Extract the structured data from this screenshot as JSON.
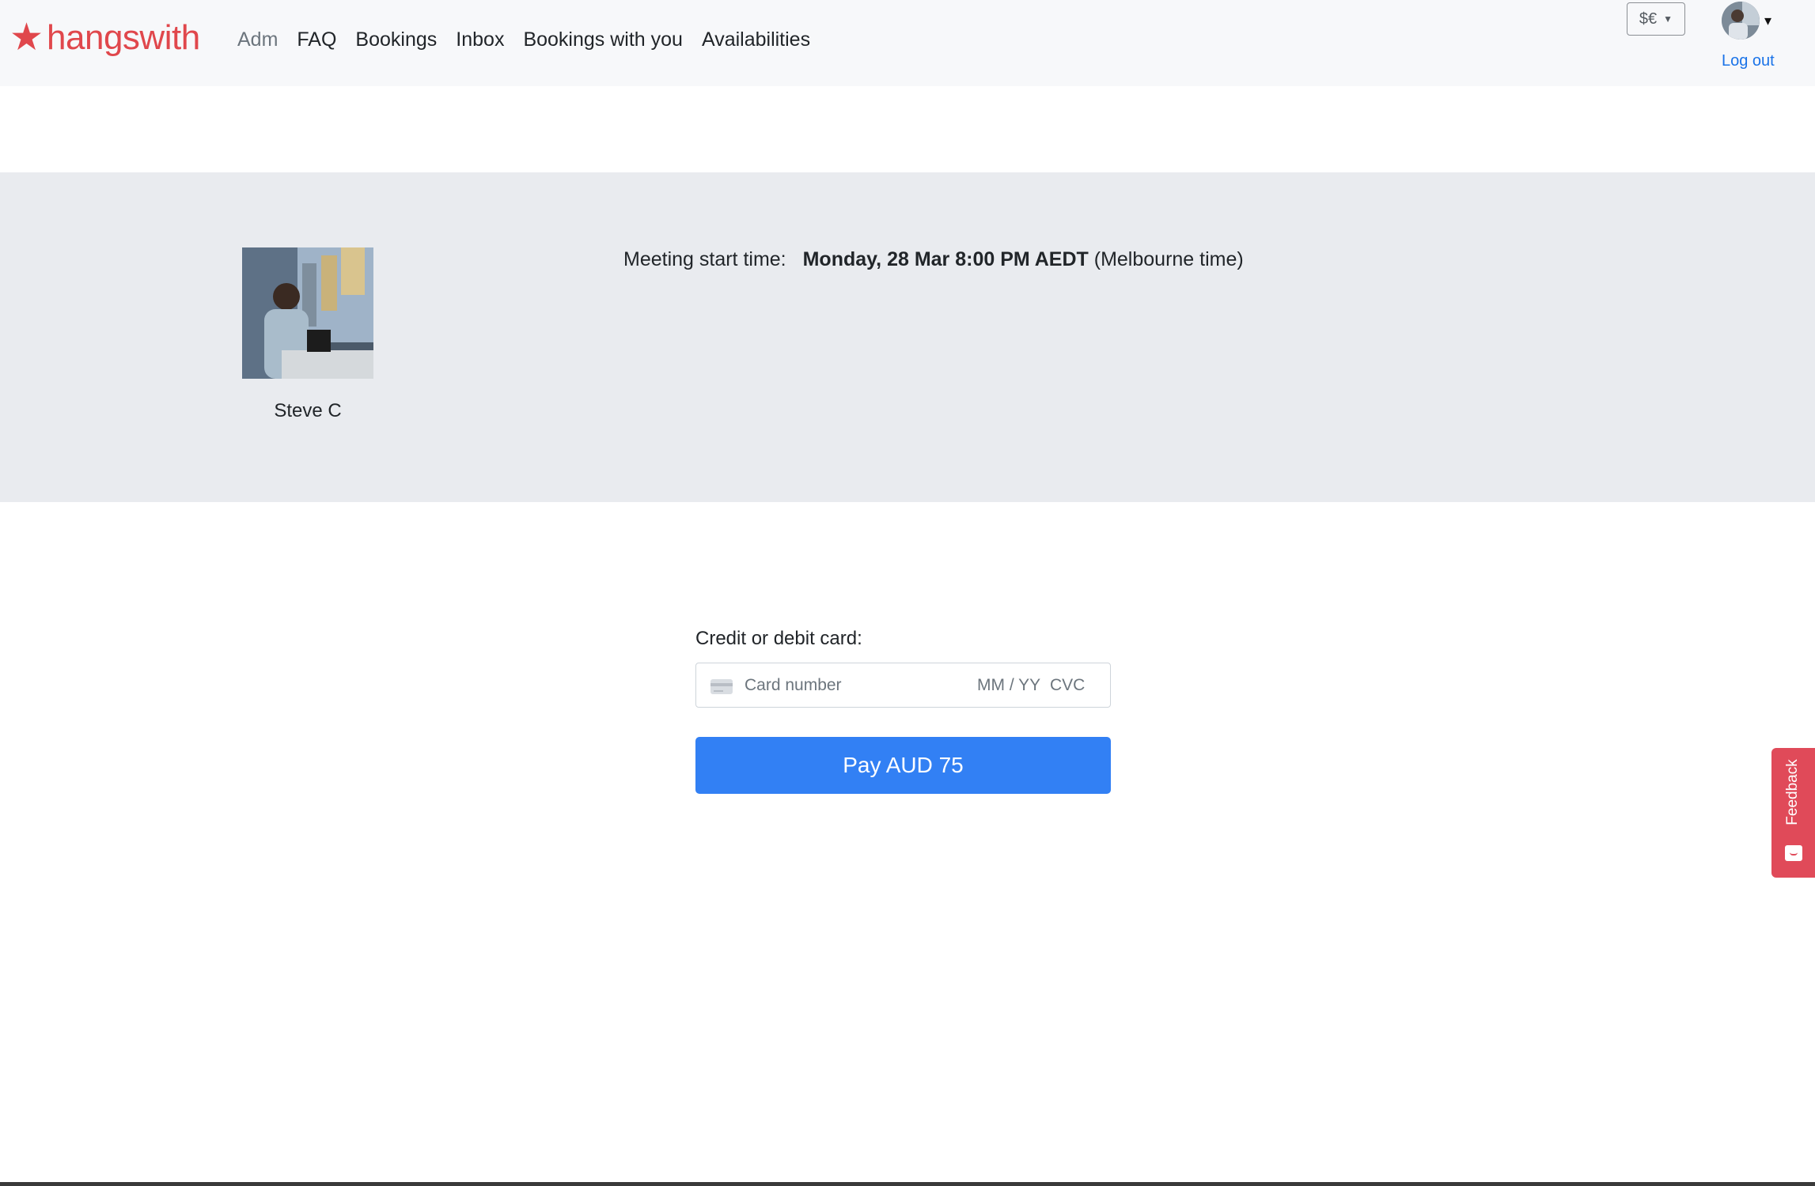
{
  "brand": {
    "star": "★",
    "name": "hangswith",
    "color": "#e0474c"
  },
  "nav": {
    "items": [
      {
        "label": "Adm",
        "muted": true
      },
      {
        "label": "FAQ"
      },
      {
        "label": "Bookings"
      },
      {
        "label": "Inbox"
      },
      {
        "label": "Bookings with you"
      },
      {
        "label": "Availabilities"
      }
    ]
  },
  "header": {
    "currency_selected": "$€",
    "currency_caret_icon": "caret-down-icon",
    "avatar_caret": "▾",
    "logout_label": "Log out"
  },
  "meeting": {
    "host_name": "Steve C",
    "start_label": "Meeting start time:",
    "start_value": "Monday, 28 Mar 8:00 PM AEDT",
    "timezone_note": "(Melbourne time)"
  },
  "payment": {
    "card_label": "Credit or debit card:",
    "card_number_placeholder": "Card number",
    "expiry_placeholder": "MM / YY",
    "cvc_placeholder": "CVC",
    "pay_button_label": "Pay AUD 75",
    "pay_button_color": "#3280f4"
  },
  "feedback": {
    "label": "Feedback",
    "color": "#e04a59"
  }
}
